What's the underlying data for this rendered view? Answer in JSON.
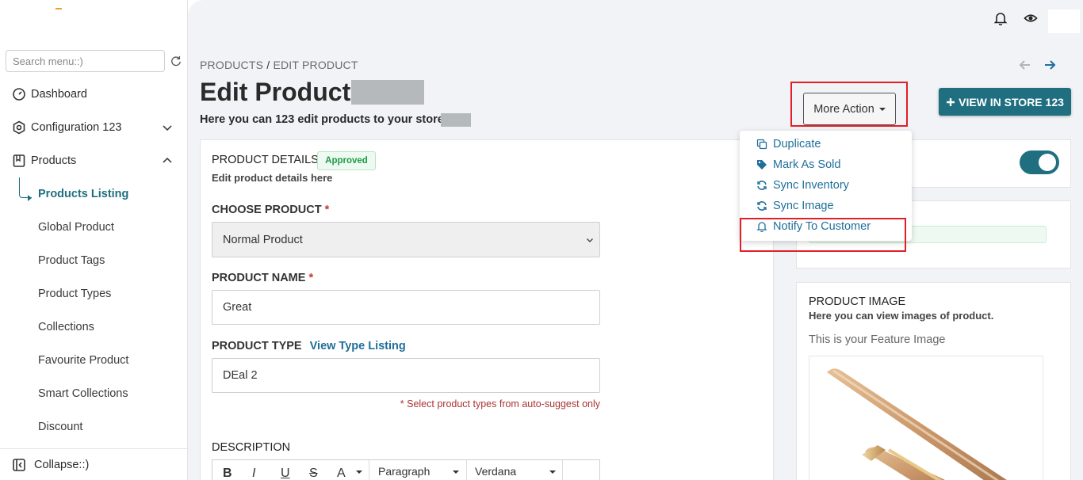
{
  "sidebar": {
    "search_placeholder": "Search menu::)",
    "items": [
      {
        "label": "Dashboard"
      },
      {
        "label": "Configuration 123"
      },
      {
        "label": "Products"
      }
    ],
    "products_submenu": [
      {
        "label": "Products Listing",
        "active": true
      },
      {
        "label": "Global Product"
      },
      {
        "label": "Product Tags"
      },
      {
        "label": "Product Types"
      },
      {
        "label": "Collections"
      },
      {
        "label": "Favourite Product"
      },
      {
        "label": "Smart Collections"
      },
      {
        "label": "Discount"
      }
    ],
    "collapse_label": "Collapse::)"
  },
  "breadcrumb": {
    "root": "PRODUCTS",
    "separator": "/",
    "current": "EDIT PRODUCT"
  },
  "page": {
    "title": "Edit Product",
    "subtitle": "Here you can 123 edit products to your store."
  },
  "actions": {
    "more_action_label": "More Action",
    "view_store_label": "VIEW IN STORE 123",
    "view_store_icon": "plus-icon"
  },
  "more_action_menu": [
    {
      "label": "Duplicate",
      "icon": "copy-icon"
    },
    {
      "label": "Mark As Sold",
      "icon": "tags-icon"
    },
    {
      "label": "Sync Inventory",
      "icon": "sync-icon"
    },
    {
      "label": "Sync Image",
      "icon": "sync-icon"
    },
    {
      "label": "Notify To Customer",
      "icon": "bell-icon"
    }
  ],
  "product_details": {
    "title": "PRODUCT DETAILS",
    "status_badge": "Approved",
    "description": "Edit product details here",
    "choose_product_label": "CHOOSE PRODUCT",
    "choose_product_value": "Normal Product",
    "product_name_label": "PRODUCT NAME",
    "product_name_value": "Great",
    "product_type_label": "PRODUCT TYPE",
    "product_type_link": "View Type Listing",
    "product_type_value": "DEal 2",
    "product_type_hint": "* Select product types from auto-suggest only",
    "required_marker": "*",
    "description_label": "DESCRIPTION",
    "editor_toolbar": {
      "bold": "B",
      "italic": "I",
      "underline": "U",
      "strike": "S",
      "font_color": "A",
      "block_format": "Paragraph",
      "font_family": "Verdana"
    }
  },
  "product_image": {
    "title": "PRODUCT IMAGE",
    "description": "Here you can view images of product.",
    "feature_note": "This is your Feature Image"
  },
  "colors": {
    "accent": "#1f6f80",
    "link": "#1f6f9a",
    "highlight": "#e41e26",
    "approved": "#1f9a45"
  }
}
